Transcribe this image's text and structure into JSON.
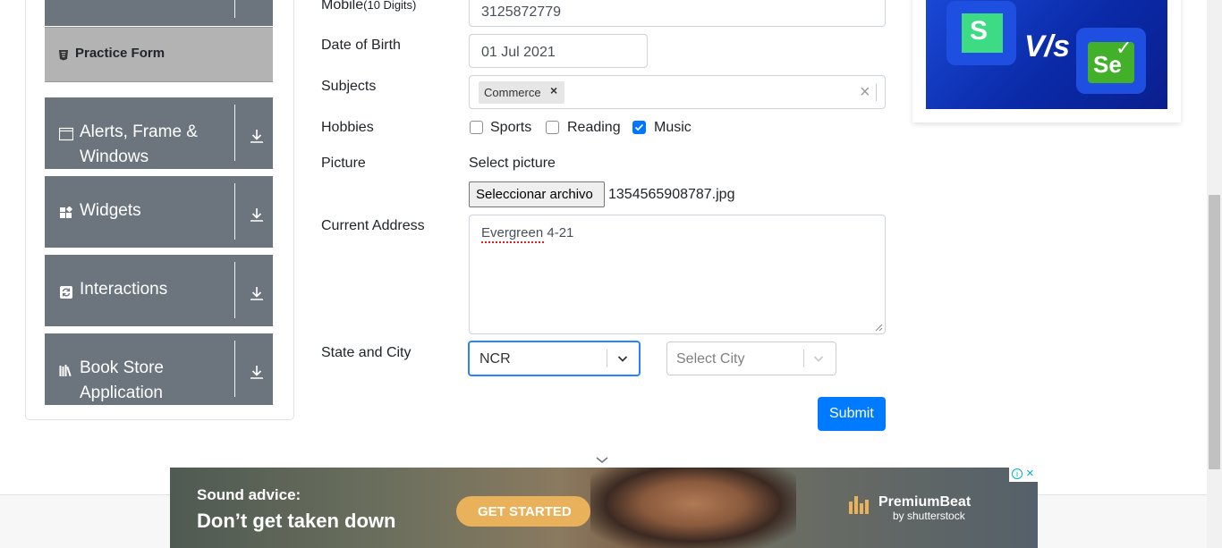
{
  "sidebar": {
    "practice_form": "Practice Form",
    "groups": [
      {
        "label": "Alerts, Frame & Windows",
        "icon": "window-icon"
      },
      {
        "label": "Widgets",
        "icon": "widgets-icon"
      },
      {
        "label": "Interactions",
        "icon": "interactions-icon"
      },
      {
        "label": "Book Store Application",
        "icon": "books-icon"
      }
    ]
  },
  "form": {
    "mobile": {
      "label": "Mobile",
      "hint": "(10 Digits)",
      "value": "3125872779"
    },
    "dob": {
      "label": "Date of Birth",
      "value": "01 Jul 2021"
    },
    "subjects": {
      "label": "Subjects",
      "chips": [
        "Commerce"
      ],
      "clear": "×"
    },
    "hobbies": {
      "label": "Hobbies",
      "options": [
        {
          "label": "Sports",
          "checked": false
        },
        {
          "label": "Reading",
          "checked": false
        },
        {
          "label": "Music",
          "checked": true
        }
      ]
    },
    "picture": {
      "label": "Picture",
      "select_label": "Select picture",
      "button": "Seleccionar archivo",
      "filename": "1354565908787.jpg"
    },
    "address": {
      "label": "Current Address",
      "value": "Evergreen 4-21"
    },
    "state_city": {
      "label": "State and City",
      "state": "NCR",
      "city_placeholder": "Select City"
    },
    "submit": "Submit"
  },
  "right_ad": {
    "vs_text": "V/s"
  },
  "bottom_ad": {
    "line1": "Sound advice:",
    "line2": "Don’t get taken down",
    "cta": "GET STARTED",
    "brand": "PremiumBeat",
    "brand_sub": "by shutterstock"
  },
  "colors": {
    "primary": "#007bff",
    "sidebar_group": "#6c757d",
    "active_item": "#b3b3b3",
    "cta": "#e9b25a"
  }
}
